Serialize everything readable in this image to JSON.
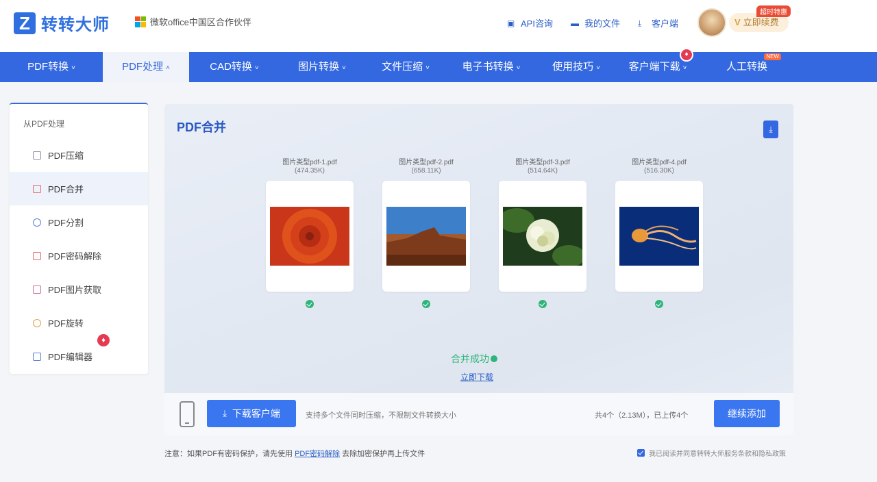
{
  "header": {
    "logo_mark": "Z",
    "logo_text": "转转大师",
    "partner_text": "微软office中国区合作伙伴",
    "links": [
      {
        "label": "API咨询",
        "icon": "chat-icon"
      },
      {
        "label": "我的文件",
        "icon": "folder-icon"
      },
      {
        "label": "客户端",
        "icon": "download-icon"
      }
    ],
    "vip_label": "立即续费",
    "vip_mark": "V",
    "hot_badge": "超时特惠"
  },
  "nav": {
    "items": [
      {
        "label": "PDF转换",
        "chevron": "˅"
      },
      {
        "label": "PDF处理",
        "chevron": "˄"
      },
      {
        "label": "CAD转换",
        "chevron": "˅"
      },
      {
        "label": "图片转换",
        "chevron": "˅"
      },
      {
        "label": "文件压缩",
        "chevron": "˅"
      },
      {
        "label": "电子书转换",
        "chevron": "˅"
      },
      {
        "label": "使用技巧",
        "chevron": "˅"
      },
      {
        "label": "客户端下载",
        "chevron": "˅"
      },
      {
        "label": "人工转换",
        "chevron": ""
      }
    ],
    "new_tag": "NEW"
  },
  "sidebar": {
    "title": "从PDF处理",
    "items": [
      {
        "label": "PDF压缩"
      },
      {
        "label": "PDF合并"
      },
      {
        "label": "PDF分割"
      },
      {
        "label": "PDF密码解除"
      },
      {
        "label": "PDF图片获取"
      },
      {
        "label": "PDF旋转"
      },
      {
        "label": "PDF编辑器"
      }
    ]
  },
  "main": {
    "title": "PDF合并",
    "files": [
      {
        "name": "图片类型pdf-1.pdf",
        "size": "(474.35K)",
        "image": "red-flower"
      },
      {
        "name": "图片类型pdf-2.pdf",
        "size": "(658.11K)",
        "image": "desert"
      },
      {
        "name": "图片类型pdf-3.pdf",
        "size": "(514.64K)",
        "image": "white-flower"
      },
      {
        "name": "图片类型pdf-4.pdf",
        "size": "(516.30K)",
        "image": "jellyfish"
      }
    ],
    "success_text": "合并成功",
    "download_now": "立即下载",
    "client_button": "下载客户端",
    "support_text": "支持多个文件同时压缩，不限制文件转换大小",
    "count_text": "共4个（2.13M），已上传4个",
    "add_button": "继续添加"
  },
  "footer": {
    "note_prefix": "注意：如果PDF有密码保护，请先使用",
    "note_link": "PDF密码解除",
    "note_suffix": "去除加密保护再上传文件",
    "agree_text": "我已阅读并同意转转大师服务条款和隐私政策"
  },
  "colors": {
    "brand": "#3468e0",
    "success": "#2fb57a",
    "hot": "#e43a52"
  }
}
